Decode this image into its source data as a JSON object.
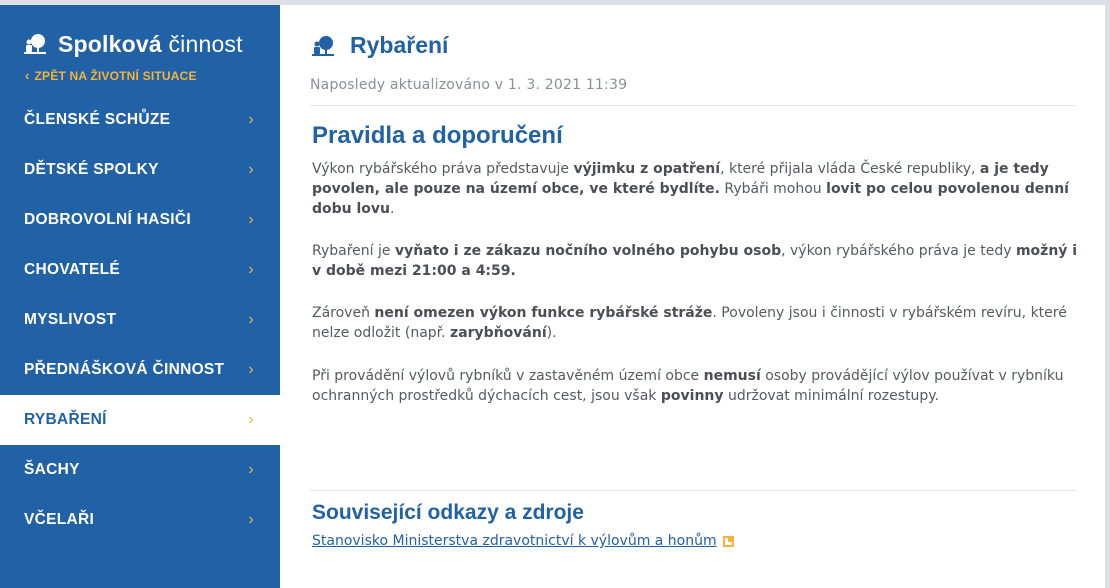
{
  "sidebar": {
    "brand_bold": "Spolková",
    "brand_rest": "činnost",
    "back_label": "ZPĚT NA ŽIVOTNÍ SITUACE",
    "items": [
      {
        "label": "ČLENSKÉ SCHŮZE"
      },
      {
        "label": "DĚTSKÉ SPOLKY"
      },
      {
        "label": "DOBROVOLNÍ HASIČI"
      },
      {
        "label": "CHOVATELÉ"
      },
      {
        "label": "MYSLIVOST"
      },
      {
        "label": "PŘEDNÁŠKOVÁ ČINNOST"
      },
      {
        "label": "RYBAŘENÍ",
        "active": true
      },
      {
        "label": "ŠACHY"
      },
      {
        "label": "VČELAŘI"
      }
    ],
    "arrow_glyph": "›",
    "back_glyph": "‹"
  },
  "main": {
    "title": "Rybaření",
    "updated": "Naposledy aktualizováno v 1. 3. 2021 11:39",
    "section_title": "Pravidla a doporučení",
    "paragraphs": [
      [
        {
          "t": "Výkon rybářského práva představuje "
        },
        {
          "t": "výjimku z opatření",
          "b": true
        },
        {
          "t": ", které přijala vláda České republiky, "
        },
        {
          "t": "a je tedy povolen, ale pouze na území obce, ve které bydlíte.",
          "b": true
        },
        {
          "t": " Rybáři mohou "
        },
        {
          "t": "lovit po celou povolenou denní dobu lovu",
          "b": true
        },
        {
          "t": "."
        }
      ],
      [
        {
          "t": "Rybaření je "
        },
        {
          "t": "vyňato i ze zákazu nočního volného pohybu osob",
          "b": true
        },
        {
          "t": ", výkon rybářského práva je tedy "
        },
        {
          "t": "možný i v době mezi 21:00 a 4:59.",
          "b": true
        }
      ],
      [
        {
          "t": "Zároveň "
        },
        {
          "t": "není omezen výkon funkce rybářské stráže",
          "b": true
        },
        {
          "t": ". Povoleny jsou i činnosti v rybářském revíru, které nelze odložit (např. "
        },
        {
          "t": "zarybňování",
          "b": true
        },
        {
          "t": ")."
        }
      ],
      [
        {
          "t": "Při provádění výlovů rybníků v zastavěném území obce "
        },
        {
          "t": "nemusí",
          "b": true
        },
        {
          "t": " osoby provádějící výlov používat v rybníku ochranných prostředků dýchacích cest, jsou však "
        },
        {
          "t": "povinny",
          "b": true
        },
        {
          "t": " udržovat minimální rozestupy."
        }
      ]
    ],
    "related_title": "Související odkazy a zdroje",
    "related_link": "Stanovisko Ministerstva zdravotnictví k výlovům a honům"
  },
  "icons": {
    "brand": "tree-person-icon",
    "page": "tree-person-icon",
    "external": "external-link-icon"
  },
  "colors": {
    "sidebar_bg": "#2161a6",
    "accent": "#f2b43f",
    "text": "#555a60",
    "heading": "#2161a6"
  }
}
